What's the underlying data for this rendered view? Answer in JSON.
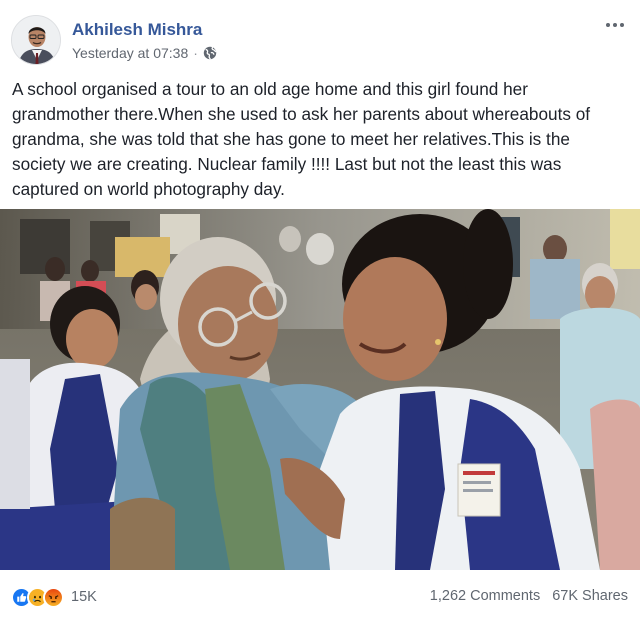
{
  "post": {
    "author": "Akhilesh Mishra",
    "timestamp": "Yesterday at 07:38",
    "separator": "·",
    "privacy_icon": "globe-icon",
    "options_icon": "more-options-icon",
    "text": "A school organised a tour to an old age home and this girl found her grandmother there.When she used to ask her parents about whereabouts of grandma, she was told that she has gone to meet her relatives.This is the society we are creating. Nuclear family !!!! Last but not the least this was captured on world photography day."
  },
  "footer": {
    "reactions": [
      "like-icon",
      "sad-icon",
      "angry-icon"
    ],
    "reaction_count": "15K",
    "comments": "1,262 Comments",
    "shares": "67K Shares"
  },
  "colors": {
    "author_link": "#365899",
    "meta_text": "#616770",
    "like_blue": "#1877f2",
    "sad_yellow": "#f7b125",
    "angry_orange": "#e9710f"
  }
}
